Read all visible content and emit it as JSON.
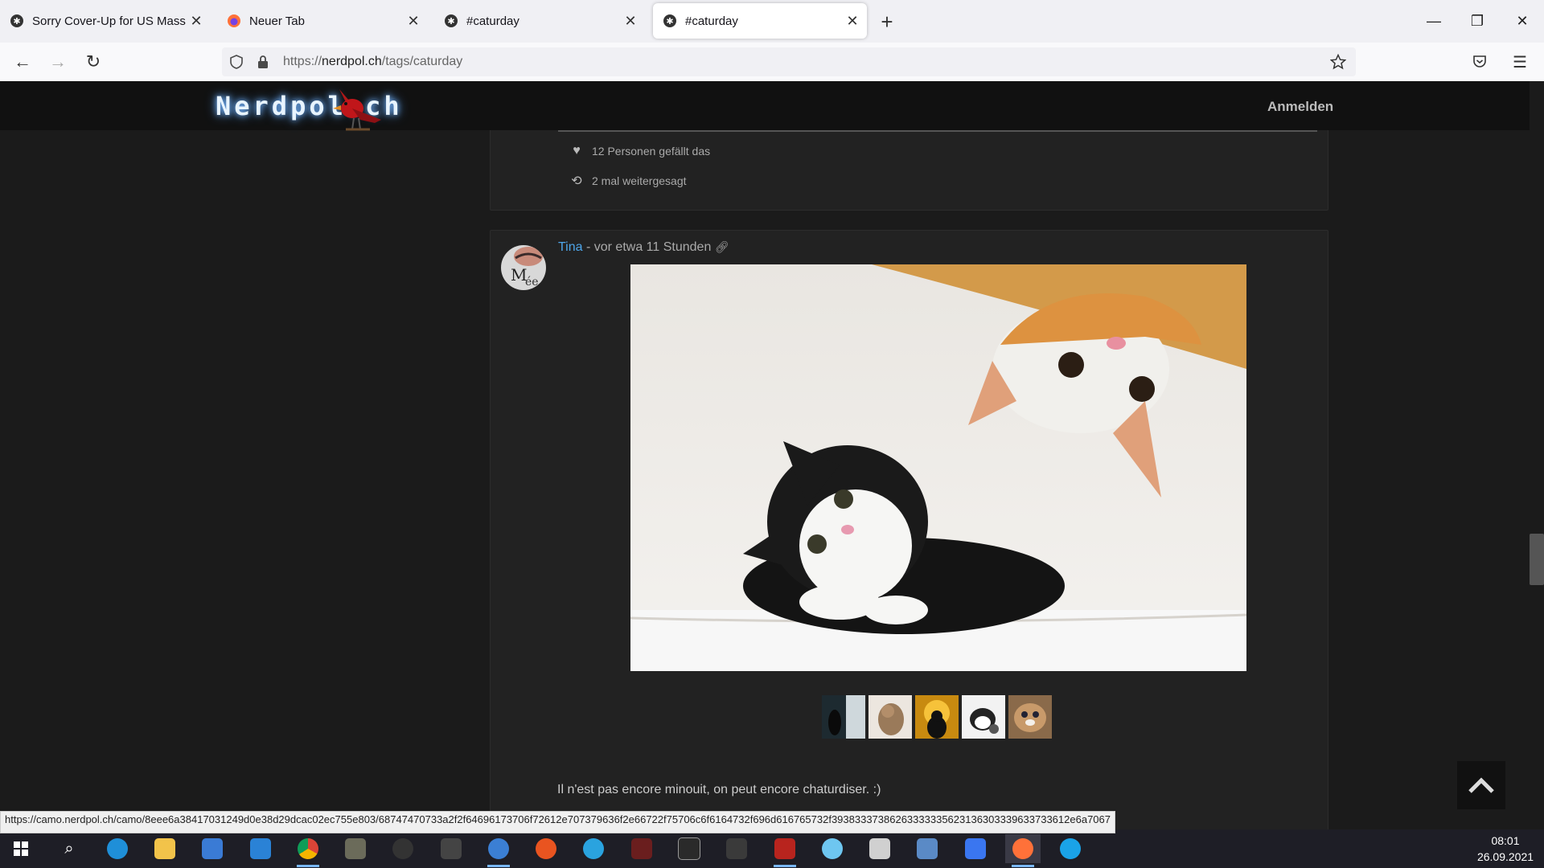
{
  "browser": {
    "tabs": [
      {
        "title": "Sorry Cover-Up for US Mass Mu",
        "icon": "diaspora-icon",
        "active": false
      },
      {
        "title": "Neuer Tab",
        "icon": "firefox-icon",
        "active": false
      },
      {
        "title": "#caturday",
        "icon": "diaspora-icon",
        "active": false
      },
      {
        "title": "#caturday",
        "icon": "diaspora-icon",
        "active": true
      }
    ],
    "url_prefix": "https://",
    "url_host": "nerdpol.ch",
    "url_path": "/tags/caturday"
  },
  "site": {
    "logo_text": "Nerdpol.ch",
    "login_label": "Anmelden"
  },
  "previous_post": {
    "likes": "12 Personen gefällt das",
    "reshares": "2 mal weitergesagt"
  },
  "post": {
    "author": "Tina",
    "time": "- vor etwa 11 Stunden",
    "text": "Il n'est pas encore minouit, on peut encore chaturdiser. :)",
    "thumbnail_count": 5
  },
  "status_url": "https://camo.nerdpol.ch/camo/8eee6a38417031249d0e38d29dcac02ec755e803/68747470733a2f2f64696173706f72612e707379636f2e66722f75706c6f6164732f696d616765732f39383337386263333335623136303339633733612e6a7067",
  "taskbar": {
    "time": "08:01",
    "date": "26.09.2021"
  },
  "colors": {
    "link": "#4ea6ea",
    "page_bg": "#1b1b1b",
    "card_bg": "#222222"
  }
}
